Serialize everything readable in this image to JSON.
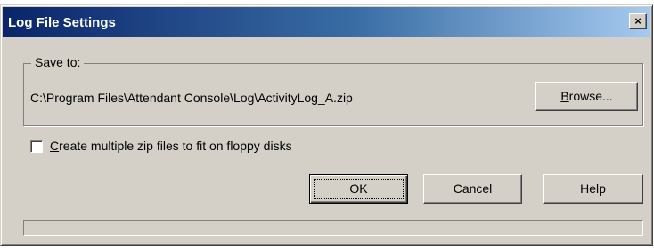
{
  "window": {
    "title": "Log File Settings",
    "close_glyph": "×"
  },
  "save_group": {
    "legend": "Save to:",
    "path": "C:\\Program Files\\Attendant Console\\Log\\ActivityLog_A.zip",
    "browse": {
      "mnemonic": "B",
      "rest": "rowse..."
    }
  },
  "options": {
    "multi_zip": {
      "checked": false,
      "mnemonic": "C",
      "rest": "reate multiple zip files to fit on floppy disks"
    }
  },
  "buttons": {
    "ok": "OK",
    "cancel": "Cancel",
    "help": "Help"
  },
  "progress": {
    "value": 0
  }
}
